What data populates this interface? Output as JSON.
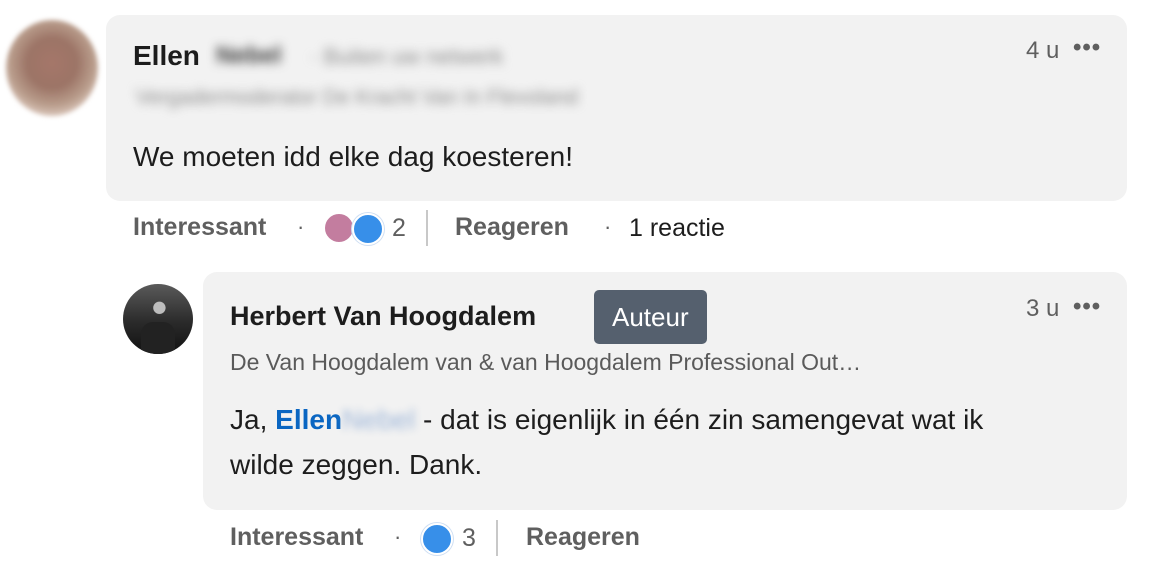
{
  "comment": {
    "author_first": "Ellen",
    "author_last_blurred": "Nebel",
    "author_extra_blurred": "· Buiten uw netwerk",
    "headline_blurred": "Vergadermoderator De Kracht Van In Flevoland",
    "timestamp": "4 u",
    "more": "•••",
    "text": "We moeten idd elke dag koesteren!",
    "actions": {
      "like_label": "Interessant",
      "dot": "·",
      "reaction_count": "2",
      "reply_label": "Reageren",
      "replies": "1 reactie"
    }
  },
  "reply": {
    "author": "Herbert Van Hoogdalem",
    "badge": "Auteur",
    "headline": "De Van Hoogdalem van & van Hoogdalem Professional Out…",
    "timestamp": "3 u",
    "more": "•••",
    "text_prefix": "Ja, ",
    "mention_first": "Ellen",
    "mention_last_blurred": "Nebel",
    "text_line1_rest": " - dat is eigenlijk in één zin samengevat wat ik",
    "text_line2": "wilde zeggen. Dank.",
    "actions": {
      "like_label": "Interessant",
      "dot": "·",
      "reaction_count": "3",
      "reply_label": "Reageren"
    }
  },
  "colors": {
    "bubble": "#f2f2f2",
    "mention": "#0a66c2",
    "badge": "#55606e",
    "like_icon": "#378fe9"
  }
}
